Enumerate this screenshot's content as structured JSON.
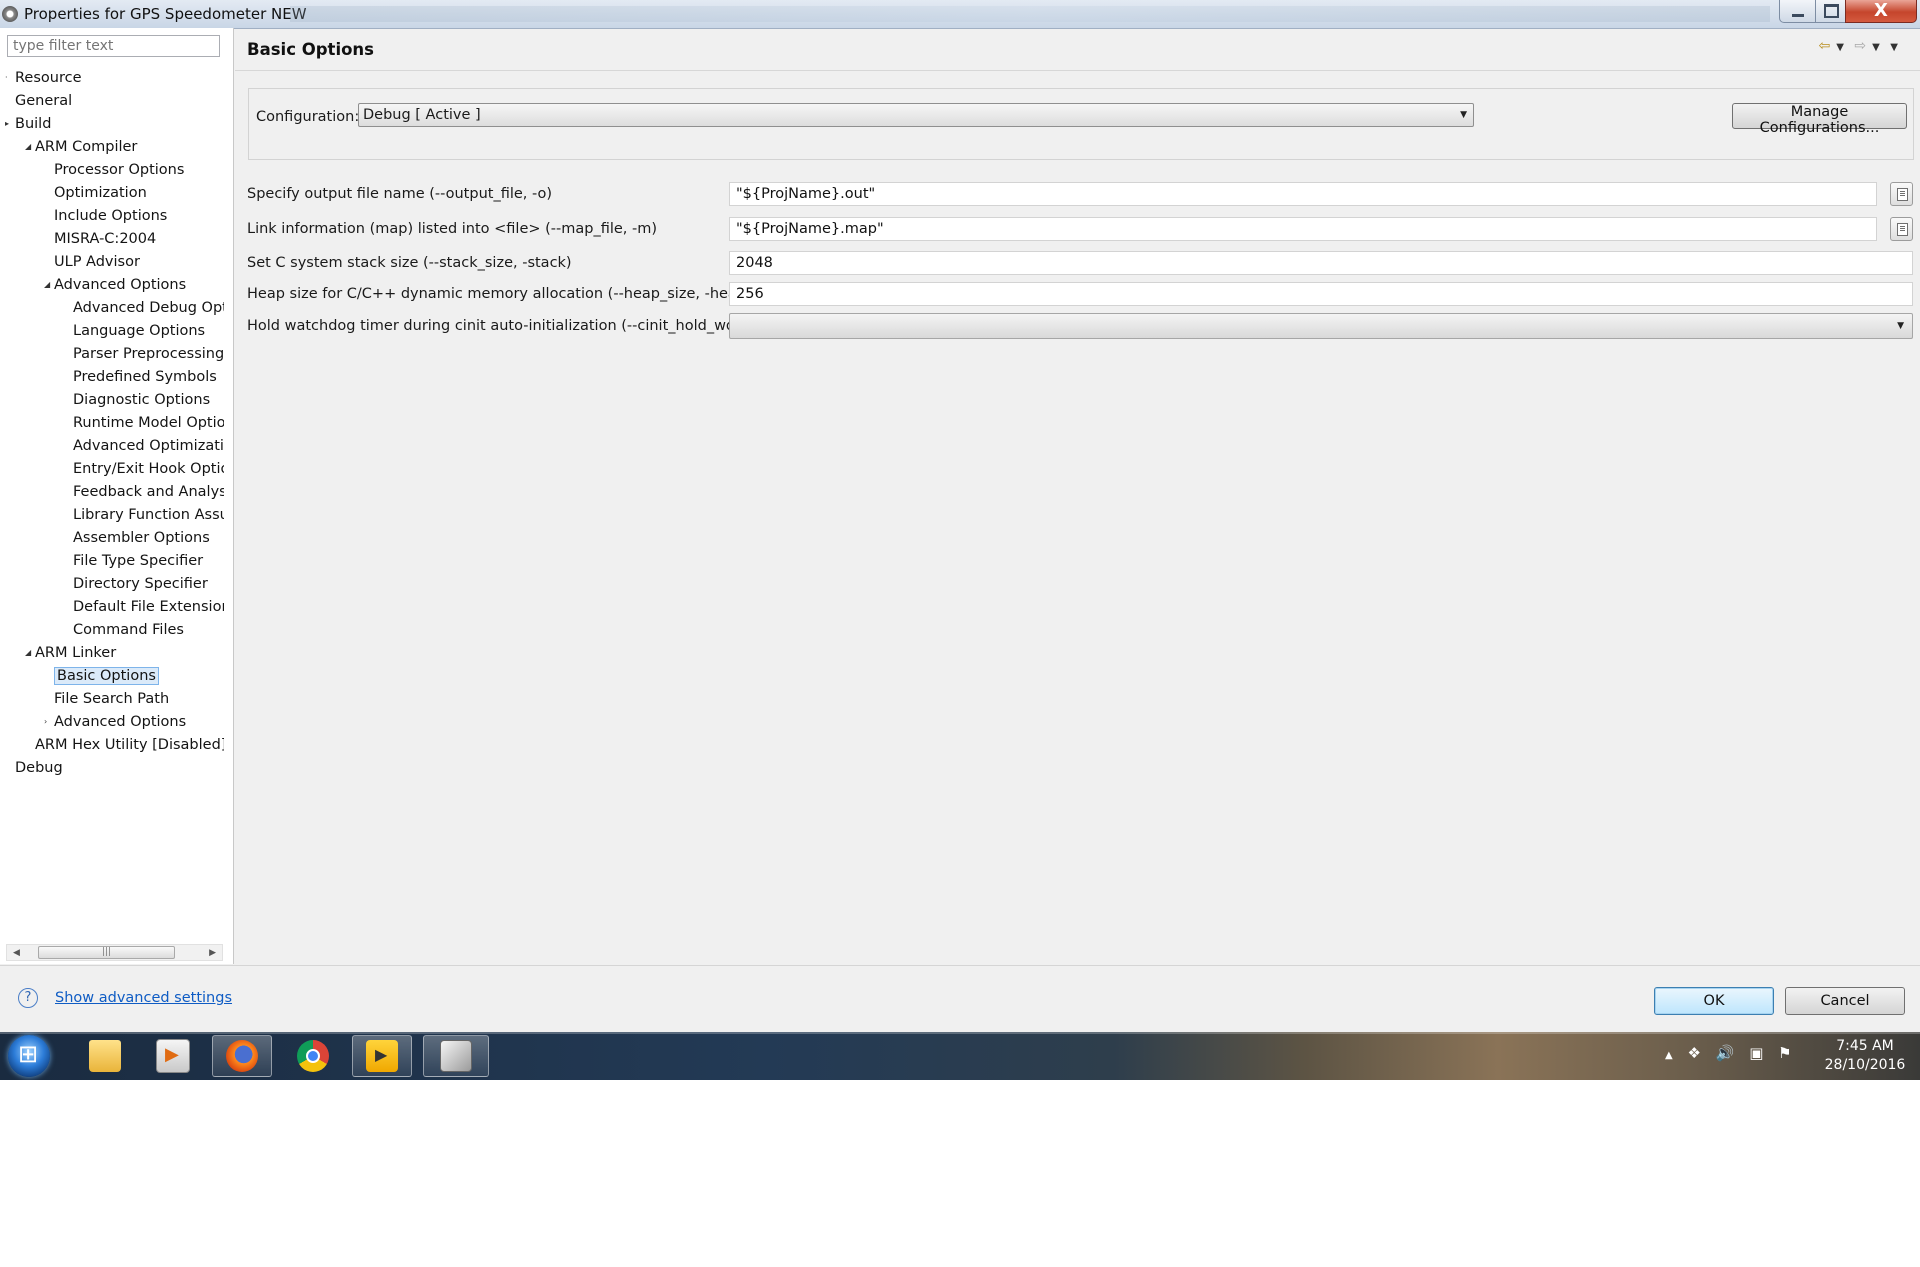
{
  "window": {
    "title": "Properties for GPS Speedometer NEW",
    "controls": {
      "minimize": "",
      "maximize": "",
      "close": "X"
    }
  },
  "filter": {
    "placeholder": "type filter text"
  },
  "tree": {
    "items": [
      {
        "label": "Resource",
        "level": 0,
        "toggle": "·"
      },
      {
        "label": "General",
        "level": 0,
        "toggle": ""
      },
      {
        "label": "Build",
        "level": 0,
        "toggle": "▸"
      },
      {
        "label": "ARM Compiler",
        "level": 1,
        "toggle": "◢"
      },
      {
        "label": "Processor Options",
        "level": 2,
        "toggle": ""
      },
      {
        "label": "Optimization",
        "level": 2,
        "toggle": ""
      },
      {
        "label": "Include Options",
        "level": 2,
        "toggle": ""
      },
      {
        "label": "MISRA-C:2004",
        "level": 2,
        "toggle": ""
      },
      {
        "label": "ULP Advisor",
        "level": 2,
        "toggle": ""
      },
      {
        "label": "Advanced Options",
        "level": 2,
        "toggle": "◢"
      },
      {
        "label": "Advanced Debug Opti",
        "level": 3,
        "toggle": ""
      },
      {
        "label": "Language Options",
        "level": 3,
        "toggle": ""
      },
      {
        "label": "Parser Preprocessing O",
        "level": 3,
        "toggle": ""
      },
      {
        "label": "Predefined Symbols",
        "level": 3,
        "toggle": ""
      },
      {
        "label": "Diagnostic Options",
        "level": 3,
        "toggle": ""
      },
      {
        "label": "Runtime Model Optior",
        "level": 3,
        "toggle": ""
      },
      {
        "label": "Advanced Optimizatio",
        "level": 3,
        "toggle": ""
      },
      {
        "label": "Entry/Exit Hook Optior",
        "level": 3,
        "toggle": ""
      },
      {
        "label": "Feedback and Analysis",
        "level": 3,
        "toggle": ""
      },
      {
        "label": "Library Function Assum",
        "level": 3,
        "toggle": ""
      },
      {
        "label": "Assembler Options",
        "level": 3,
        "toggle": ""
      },
      {
        "label": "File Type Specifier",
        "level": 3,
        "toggle": ""
      },
      {
        "label": "Directory Specifier",
        "level": 3,
        "toggle": ""
      },
      {
        "label": "Default File Extensions",
        "level": 3,
        "toggle": ""
      },
      {
        "label": "Command Files",
        "level": 3,
        "toggle": ""
      },
      {
        "label": "ARM Linker",
        "level": 1,
        "toggle": "◢"
      },
      {
        "label": "Basic Options",
        "level": 2,
        "toggle": "",
        "selected": true
      },
      {
        "label": "File Search Path",
        "level": 2,
        "toggle": ""
      },
      {
        "label": "Advanced Options",
        "level": 2,
        "toggle": "›"
      },
      {
        "label": "ARM Hex Utility  [Disabled]",
        "level": 1,
        "toggle": ""
      },
      {
        "label": "Debug",
        "level": 0,
        "toggle": ""
      }
    ]
  },
  "header": {
    "title": "Basic Options",
    "nav": {
      "back": "⇦",
      "back_menu": "▼",
      "forward": "⇨",
      "forward_menu": "▼",
      "view_menu": "▼"
    }
  },
  "config": {
    "label": "Configuration:",
    "value": "Debug  [ Active ]",
    "manage_label": "Manage Configurations..."
  },
  "options": {
    "output_file": {
      "label": "Specify output file name (--output_file, -o)",
      "value": "\"${ProjName}.out\""
    },
    "map_file": {
      "label": "Link information (map) listed into <file> (--map_file, -m)",
      "value": "\"${ProjName}.map\""
    },
    "stack_size": {
      "label": "Set C system stack size (--stack_size, -stack)",
      "value": "2048"
    },
    "heap_size": {
      "label": "Heap size for C/C++ dynamic memory allocation (--heap_size, -heap)",
      "value": "256"
    },
    "cinit_hold_wdt": {
      "label": "Hold watchdog timer during cinit auto-initialization (--cinit_hold_wdt)",
      "value": ""
    }
  },
  "footer": {
    "help": "?",
    "advanced_link": "Show advanced settings",
    "ok_label": "OK",
    "cancel_label": "Cancel"
  },
  "taskbar": {
    "apps": [
      "folder-icon",
      "media-center-icon",
      "firefox-icon",
      "chrome-icon",
      "media-player-icon",
      "code-composer-icon"
    ],
    "tray": {
      "show_hidden": "▲",
      "dropbox": "❖",
      "volume": "🔊",
      "network": "▣",
      "flag": "⚑"
    },
    "time": "7:45 AM",
    "date": "28/10/2016"
  }
}
